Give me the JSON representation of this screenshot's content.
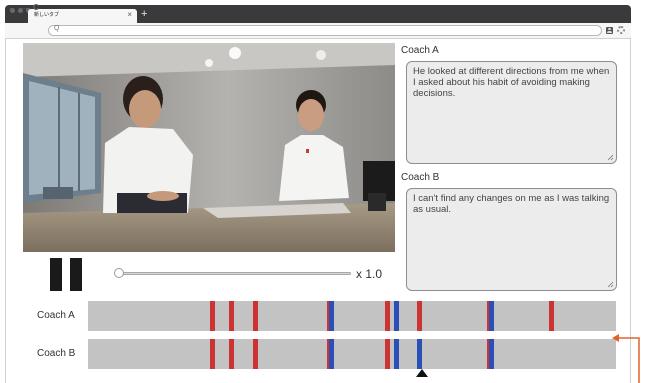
{
  "browser": {
    "tab_title": "新しいタブ",
    "tab_close": "×",
    "new_tab": "+",
    "back": "←",
    "forward": "→",
    "reload": "C",
    "search_glyph": "Q",
    "url": ""
  },
  "notes": [
    {
      "label": "Coach A",
      "text": "He looked at different directions from me when I asked about his habit of avoiding making decisions."
    },
    {
      "label": "Coach B",
      "text": "I can't find any changes on me as I was talking as usual."
    }
  ],
  "player": {
    "state": "playing",
    "progress": 0,
    "speed_label": "x 1.0"
  },
  "timeline": {
    "colors": {
      "red": "#cc3333",
      "blue": "#2a4fb8",
      "track": "#c3c3c3",
      "arrow": "#e0622a"
    },
    "rows": [
      {
        "label": "Coach A",
        "marks": [
          {
            "pos": 0.235,
            "color": "red"
          },
          {
            "pos": 0.272,
            "color": "red"
          },
          {
            "pos": 0.318,
            "color": "red"
          },
          {
            "pos": 0.458,
            "color": "red"
          },
          {
            "pos": 0.462,
            "color": "blue"
          },
          {
            "pos": 0.567,
            "color": "red"
          },
          {
            "pos": 0.585,
            "color": "blue"
          },
          {
            "pos": 0.627,
            "color": "red"
          },
          {
            "pos": 0.76,
            "color": "red"
          },
          {
            "pos": 0.765,
            "color": "blue"
          },
          {
            "pos": 0.877,
            "color": "red"
          }
        ]
      },
      {
        "label": "Coach B",
        "marks": [
          {
            "pos": 0.235,
            "color": "red"
          },
          {
            "pos": 0.272,
            "color": "red"
          },
          {
            "pos": 0.318,
            "color": "red"
          },
          {
            "pos": 0.458,
            "color": "red"
          },
          {
            "pos": 0.462,
            "color": "blue"
          },
          {
            "pos": 0.567,
            "color": "red"
          },
          {
            "pos": 0.585,
            "color": "blue"
          },
          {
            "pos": 0.627,
            "color": "blue"
          },
          {
            "pos": 0.76,
            "color": "red"
          },
          {
            "pos": 0.765,
            "color": "blue"
          }
        ]
      }
    ],
    "playhead_position": 0.632
  }
}
